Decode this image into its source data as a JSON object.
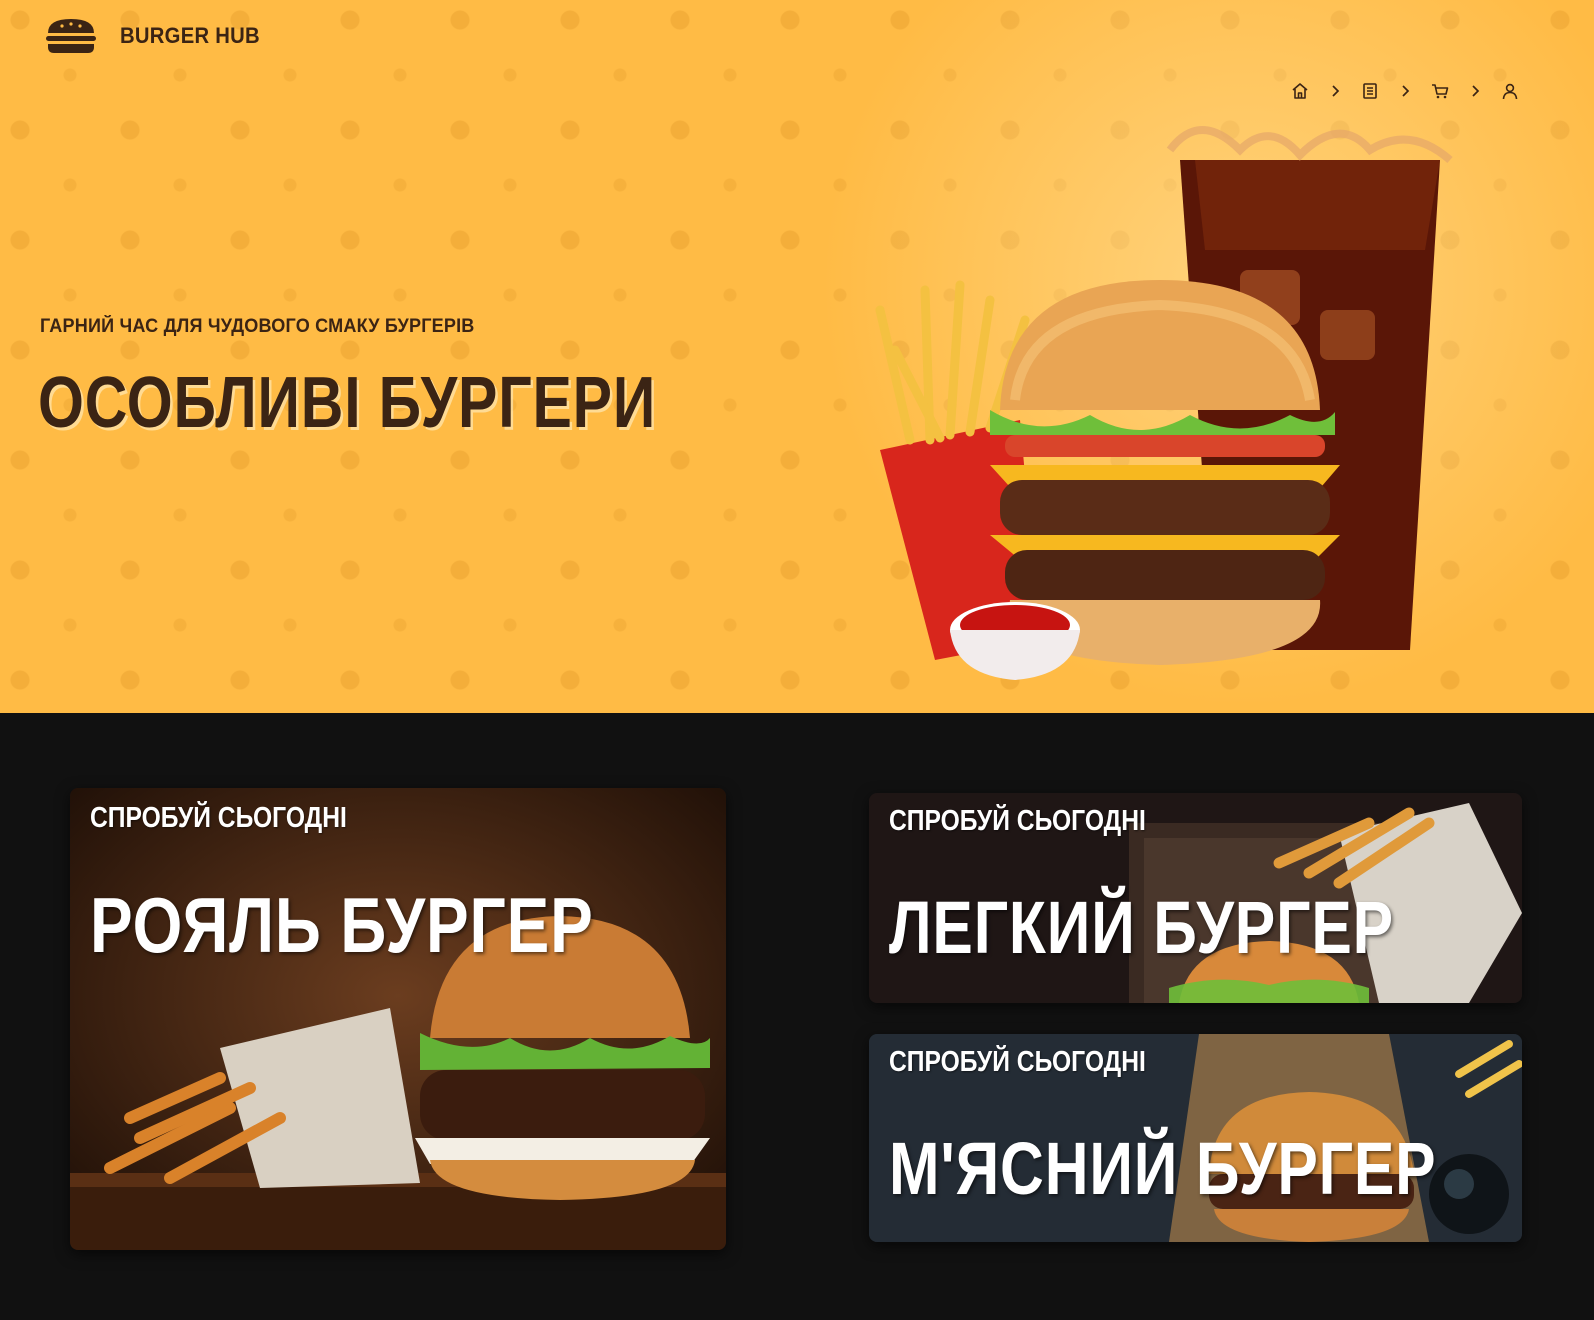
{
  "brand": {
    "name": "BURGER HUB",
    "logo_icon": "burger-logo-icon"
  },
  "nav": {
    "items": [
      {
        "icon": "home-icon"
      },
      {
        "icon": "menu-list-icon"
      },
      {
        "icon": "cart-icon"
      },
      {
        "icon": "user-icon"
      }
    ],
    "separator_icon": "chevron-right-icon"
  },
  "hero": {
    "subtitle": "ГАРНИЙ ЧАС ДЛЯ ЧУДОВОГО СМАКУ БУРГЕРІВ",
    "title": "ОСОБЛИВІ БУРГЕРИ",
    "background_color": "#ffbb45",
    "text_color": "#3b2414"
  },
  "promos": [
    {
      "tag": "СПРОБУЙ СЬОГОДНІ",
      "name": "РОЯЛЬ БУРГЕР"
    },
    {
      "tag": "СПРОБУЙ СЬОГОДНІ",
      "name": "ЛЕГКИЙ БУРГЕР"
    },
    {
      "tag": "СПРОБУЙ СЬОГОДНІ",
      "name": "М'ЯСНИЙ БУРГЕР"
    }
  ],
  "colors": {
    "page_bg": "#111111",
    "accent": "#ffbb45",
    "dark_brown": "#3b2414"
  }
}
